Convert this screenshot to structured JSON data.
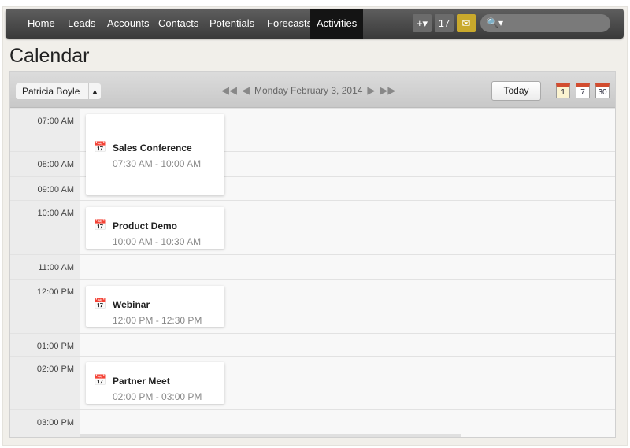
{
  "nav": {
    "items": [
      "Home",
      "Leads",
      "Accounts",
      "Contacts",
      "Potentials",
      "Forecasts",
      "Activities"
    ],
    "active": "Activities",
    "tools": [
      {
        "name": "quick-create-icon",
        "glyph": "+▾"
      },
      {
        "name": "calendar-icon",
        "glyph": "17"
      },
      {
        "name": "mail-icon",
        "glyph": "✉"
      }
    ],
    "search_icon": "🔍▾",
    "search_placeholder": ""
  },
  "page": {
    "title": "Calendar"
  },
  "toolbar": {
    "user": "Patricia Boyle",
    "date": "Monday February 3, 2014",
    "today": "Today",
    "views": [
      "1",
      "7",
      "30"
    ]
  },
  "rows": [
    {
      "label": "07:00 AM"
    },
    {
      "label": "08:00 AM"
    },
    {
      "label": "09:00 AM"
    },
    {
      "label": "10:00 AM"
    },
    {
      "label": "11:00 AM"
    },
    {
      "label": "12:00 PM"
    },
    {
      "label": "01:00 PM"
    },
    {
      "label": "02:00 PM"
    },
    {
      "label": "03:00 PM"
    }
  ],
  "events": [
    {
      "name": "Sales Conference",
      "time": "07:30 AM - 10:00 AM"
    },
    {
      "name": "Product Demo",
      "time": "10:00 AM - 10:30 AM"
    },
    {
      "name": "Webinar",
      "time": "12:00 PM - 12:30 PM"
    },
    {
      "name": "Partner Meet",
      "time": "02:00 PM - 03:00 PM"
    }
  ]
}
